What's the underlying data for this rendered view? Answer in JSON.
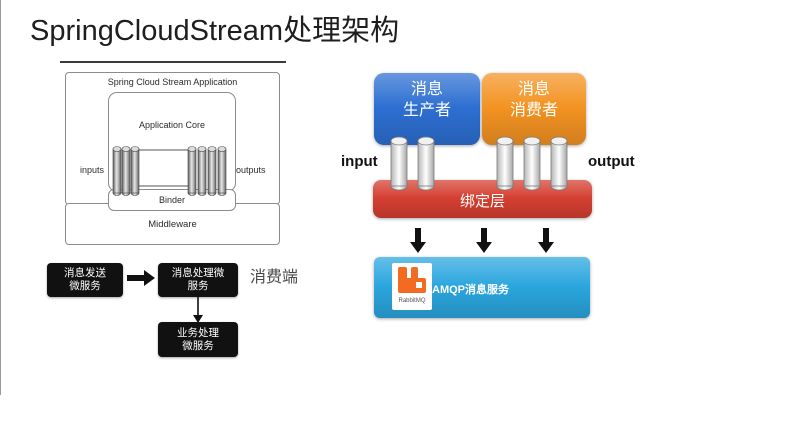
{
  "title": "SpringCloudStream处理架构",
  "scs_diagram": {
    "application_label": "Spring Cloud Stream Application",
    "core_label": "Application Core",
    "binder_label": "Binder",
    "middleware_label": "Middleware",
    "inputs_label": "inputs",
    "outputs_label": "outputs"
  },
  "flow": {
    "sender": {
      "line1": "消息发送",
      "line2": "微服务"
    },
    "processor": {
      "line1": "消息处理微",
      "line2": "服务"
    },
    "consumer_side_label": "消费端",
    "business": {
      "line1": "业务处理",
      "line2": "微服务"
    }
  },
  "binding_diagram": {
    "producer": {
      "line1": "消息",
      "line2": "生产者",
      "color": "#2d6fd2"
    },
    "consumer": {
      "line1": "消息",
      "line2": "消费者",
      "color": "#f39322"
    },
    "input_label": "input",
    "output_label": "output",
    "binding_layer": {
      "label": "绑定层",
      "color": "#d43f31"
    },
    "message_service": {
      "label": "AMQP消息服务",
      "logo_text": "RabbitMQ",
      "color": "#2aa6de",
      "logo_color": "#f26b21"
    }
  }
}
